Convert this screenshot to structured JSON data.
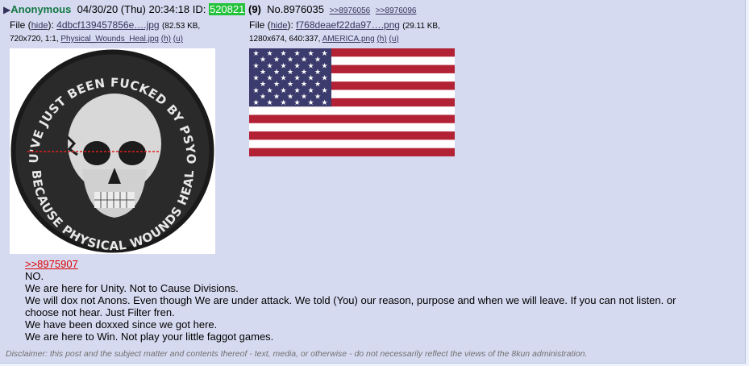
{
  "post": {
    "arrow": "▶",
    "name": "Anonymous",
    "datetime": "04/30/20 (Thu) 20:34:18",
    "id_label": "ID:",
    "poster_id": "520821",
    "reply_count": "(9)",
    "post_number": "No.8976035",
    "backlinks": [
      ">>8976056",
      ">>8976096"
    ]
  },
  "files": [
    {
      "file_label": "File",
      "hide_label": "hide",
      "filename": "4dbcf139457856e….jpg",
      "size": "(82.53 KB,",
      "dims": "720x720, 1:1,",
      "original_name": "Physical_Wounds_Heal.jpg",
      "h_link": "(h)",
      "u_link": "(u)",
      "image_desc_top": "YOU'VE JUST BEEN FUCKED BY PSYOPS",
      "image_desc_bottom": "BECAUSE PHYSICAL WOUNDS HEAL"
    },
    {
      "file_label": "File",
      "hide_label": "hide",
      "filename": "f768deaef22da97….png",
      "size": "(29.11 KB,",
      "dims": "1280x674, 640:337,",
      "original_name": "AMERICA.png",
      "h_link": "(h)",
      "u_link": "(u)"
    }
  ],
  "body": {
    "quote": ">>8975907",
    "lines": [
      "NO.",
      "We are here for Unity. Not to Cause Divisions.",
      "We will dox not Anons. Even though We are under attack. We told (You) our reason, purpose and when we will leave. If you can not listen. or choose not hear. Just Filter fren.",
      "We have been doxxed since we got here.",
      "We are here to Win. Not play your little faggot games."
    ]
  },
  "disclaimer": "Disclaimer: this post and the subject matter and contents thereof - text, media, or otherwise - do not necessarily reflect the views of the 8kun administration.",
  "colors": {
    "post_bg": "#d6daf0",
    "name": "#117743",
    "id_bg": "#22c23a",
    "quotelink": "#d00",
    "flag_red": "#b22234",
    "flag_blue": "#3c3b6e"
  }
}
